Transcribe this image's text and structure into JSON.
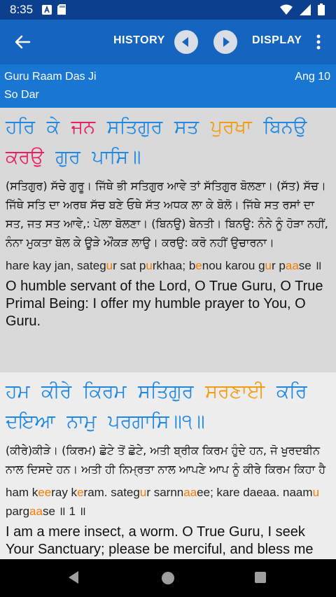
{
  "status": {
    "time": "8:35",
    "left_icons": [
      "a-notification-icon",
      "sd-card-icon"
    ],
    "right_icons": [
      "wifi-icon",
      "signal-icon",
      "battery-icon"
    ]
  },
  "toolbar": {
    "history_label": "HISTORY",
    "display_label": "DISPLAY",
    "accent": "#1565c0"
  },
  "info": {
    "author": "Guru Raam Das Ji",
    "ang": "Ang 10",
    "raag": "So Dar"
  },
  "verses": [
    {
      "gurmukhi_words": [
        "ਹਰਿ",
        "ਕੇ",
        "ਜਨ",
        "ਸਤਿਗੁਰ",
        "ਸਤ",
        "ਪੁਰਖਾ",
        "ਬਿਨਉ",
        "ਕਰਉ",
        "ਗੁਰ",
        "ਪਾਸਿ॥"
      ],
      "teeka": "(ਸਤਿਗੁਰ) ਸੱਚੇ ਗੁਰੂ। ਜਿੱਥੇ ਭੀ ਸਤਿਗੁਰ ਆਵੇ ਤਾਂ ਸੱਤਿਗੁਰ ਬੋਲਣਾ। (ਸੱਤ) ਸੱਚ। ਜਿੱਥੇ ਸਤਿ ਦਾ ਅਰਥ ਸੱਚ ਬਣੇ ਓਥੇ ਸੱਤ ਅਧਕ ਲਾ ਕੇ ਬੋਲੋ। ਜਿੱਥੇ ਸਤ ਰਸਾਂ ਦਾ ਸਤ, ਜਤ ਸਤ ਆਵੇ,: ਪੋਲਾ ਬੋਲਣਾ। (ਬਿਨਉ) ਬੇਨਤੀ। ਬਿਨਉ: ਨੰਨੇ ਨੂੰ ਹੋੜਾ ਨਹੀਂ, ਨੰਨਾ ਮੁਕਤਾ ਬੋਲ ਕੇ ਊੜੇ ਔਂਕੜ ਲਾਉ। ਕਰਉ: ਕਰੋ ਨਹੀਂ ਉਚਾਰਨਾ।",
      "transliteration": "hare kay jan, sategur sat purkhaa; benou karou gur paase ॥",
      "translation": "O humble servant of the Lord, O True Guru, O True Primal Being: I offer my humble prayer to You, O Guru."
    },
    {
      "gurmukhi_words": [
        "ਹਮ",
        "ਕੀਰੇ",
        "ਕਿਰਮ",
        "ਸਤਿਗੁਰ",
        "ਸਰਣਾਈ",
        "ਕਰਿ",
        "ਦਇਆ",
        "ਨਾਮੁ",
        "ਪਰਗਾਸਿ॥੧॥"
      ],
      "teeka": "(ਕੀਰੇ)ਕੀੜੇ। (ਕਿਰਮ) ਛੋਟੇ ਤੋਂ ਛੋਟੇ, ਅਤੀ ਬ੍ਰੀਕ ਕਿਰਮ ਹੁੰਦੇ ਹਨ, ਜੋ ਖੁਰਦਬੀਨ ਨਾਲ ਦਿਸਦੇ ਹਨ। ਅਤੀ ਹੀ ਨਿਮ੍ਰਤਾ ਨਾਲ ਆਪਣੇ ਆਪ ਨੂੰ ਕੀਰੇ ਕਿਰਮ ਕਿਹਾ ਹੈ",
      "transliteration": "ham keeray keram. sategur sarnnaaee; kare daeaa. naamu pargaase ॥ 1 ॥",
      "translation": "I am a mere insect, a worm. O True Guru, I seek Your Sanctuary; please be merciful, and bless me with the Light of the Naam."
    }
  ],
  "colors": {
    "gurmukhi_blue": "#1e88e5",
    "pink": "#e91e63",
    "orange": "#f39c12"
  },
  "nav": [
    "back-icon",
    "home-icon",
    "recents-icon"
  ]
}
